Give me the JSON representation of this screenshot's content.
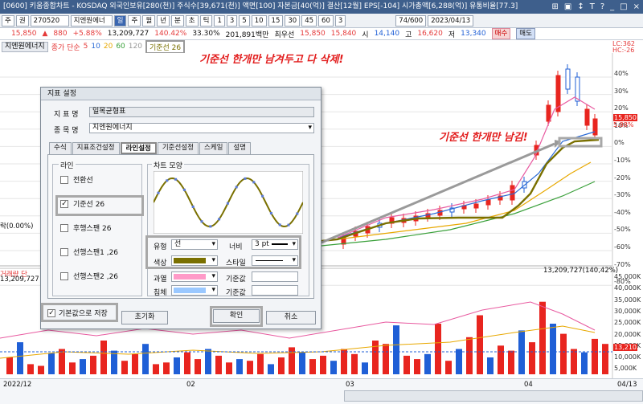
{
  "titlebar": {
    "text": "[0600] 키움종합차트 - KOSDAQ 외국인보유[280(천)] 주식수[39,671(천)] 액면[100] 자본금[40(억)] 결산[12월] EPS[-104] 시가총액[6,288(억)] 유통비율[77.3]",
    "controls": [
      "⊞",
      "▣",
      "↕",
      "T",
      "?",
      "_",
      "□",
      "×"
    ]
  },
  "toolbar": {
    "items": [
      "주",
      "권",
      "270520",
      "지엔원에너",
      "일",
      "주",
      "월",
      "년",
      "분",
      "초",
      "틱",
      "1",
      "3",
      "5",
      "10",
      "15",
      "30",
      "45",
      "60",
      "3"
    ],
    "range": "74/600",
    "date": "2023/04/13"
  },
  "quote": {
    "price": "15,850",
    "change_arrow": "▲",
    "change": "880",
    "pct": "+5.88%",
    "volume": "13,209,727",
    "vol_pct": "140.42%",
    "turnover": "33.30%",
    "amount": "201,891백만",
    "pref": "최우선",
    "ask": "15,850",
    "bid": "15,840",
    "open_l": "시",
    "open": "14,140",
    "high_l": "고",
    "high": "16,620",
    "low_l": "저",
    "low": "13,340",
    "buy": "매수",
    "sell": "매도"
  },
  "chartbar": {
    "name": "지엔원에너지",
    "ma_label": "종가 단순",
    "ma": [
      "5",
      "10",
      "20",
      "60",
      "120"
    ],
    "base_line": "기준선 26"
  },
  "annotations": {
    "top": "기준선 한개만 남겨두고 다 삭제!",
    "right": "기준선 한개만 남김!"
  },
  "price_axis": {
    "ticks": [
      "40%",
      "30%",
      "20%",
      "10%",
      "0%",
      "-10%",
      "-20%",
      "-30%",
      "-40%",
      "-50%",
      "-60%",
      "-70%",
      "-80%"
    ],
    "lc": "LC:362",
    "hc": "HC:-26",
    "price_tag": "15,850",
    "pct_tag": "5.88%"
  },
  "volume": {
    "label": "거래량 단",
    "value_left": "13,209,727",
    "value_right": "13,209,727(140,42%)",
    "ticks": [
      "45,000K",
      "40,000K",
      "35,000K",
      "30,000K",
      "25,000K",
      "20,000K",
      "15,000K",
      "10,000K",
      "5,000K"
    ],
    "tag": "13,210"
  },
  "xaxis": {
    "labels": [
      "2022/12",
      "02",
      "03",
      "04",
      "04/13"
    ]
  },
  "left_label": "락(0.00%)",
  "dialog": {
    "title": "지표 설정",
    "indicator_label": "지 표 명",
    "indicator": "일목균형표",
    "stock_label": "종 목 명",
    "stock": "지엔원에너지",
    "tabs": [
      "수식",
      "지표조건설정",
      "라인설정",
      "기준선설정",
      "스케일",
      "설명"
    ],
    "line_group": "라인",
    "lines": [
      {
        "label": "전환선",
        "checked": false
      },
      {
        "label": "기준선 26",
        "checked": true
      },
      {
        "label": "후행스팬 26",
        "checked": false
      },
      {
        "label": "선행스팬1 ,26",
        "checked": false
      },
      {
        "label": "선행스팬2 ,26",
        "checked": false
      }
    ],
    "shape_group": "차트 모양",
    "type_label": "유형",
    "type_value": "선",
    "width_label": "너비",
    "width_value": "3 pt",
    "color_label": "색상",
    "style_label": "스타일",
    "color": "#7a7000",
    "up_label": "과열",
    "up_color": "#ff9ac8",
    "ref1_label": "기준값",
    "down_label": "침체",
    "down_color": "#9ac8ff",
    "ref2_label": "기준값",
    "save_default": "기본값으로 저장",
    "reset": "초기화",
    "ok": "확인",
    "cancel": "취소"
  },
  "colors": {
    "up": "#e8251f",
    "down": "#1f5fd6",
    "base_line": "#7a7000"
  }
}
